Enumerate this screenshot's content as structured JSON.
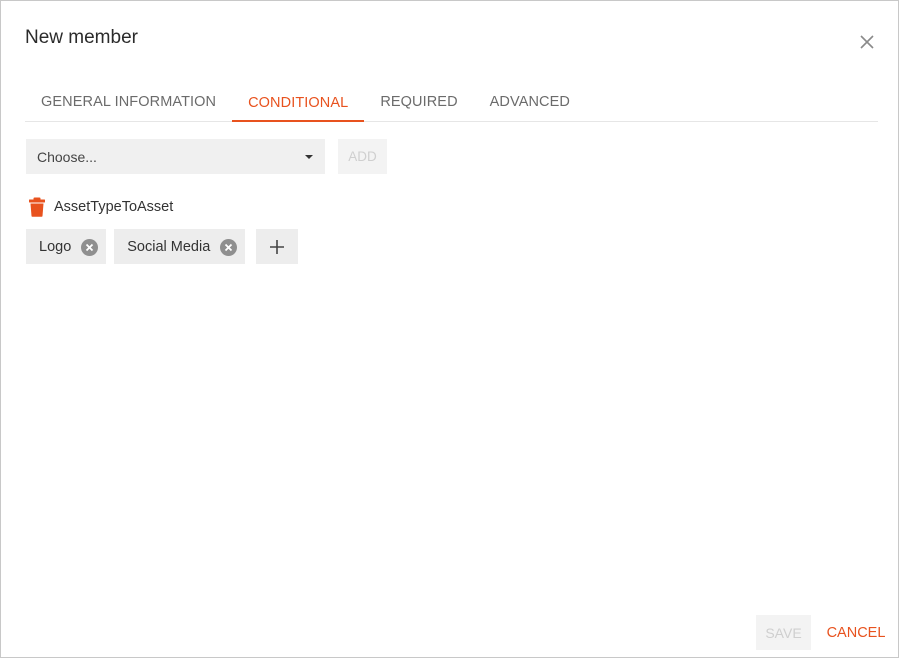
{
  "dialog": {
    "title": "New member"
  },
  "tabs": [
    {
      "label": "GENERAL INFORMATION",
      "active": false
    },
    {
      "label": "CONDITIONAL",
      "active": true
    },
    {
      "label": "REQUIRED",
      "active": false
    },
    {
      "label": "ADVANCED",
      "active": false
    }
  ],
  "conditional": {
    "select": {
      "value": "Choose..."
    },
    "add_label": "ADD",
    "condition": {
      "name": "AssetTypeToAsset",
      "values": [
        "Logo",
        "Social Media"
      ]
    }
  },
  "footer": {
    "save_label": "SAVE",
    "cancel_label": "CANCEL"
  },
  "icons": {
    "close": "close-icon",
    "trash": "trash-icon",
    "chip_remove": "remove-circle-icon",
    "add": "plus-icon",
    "dropdown": "caret-down-icon"
  },
  "colors": {
    "accent": "#e8521e",
    "disabled_text": "#cfcfcf",
    "chip_background": "#ededed",
    "input_background": "#f0f0f0"
  }
}
